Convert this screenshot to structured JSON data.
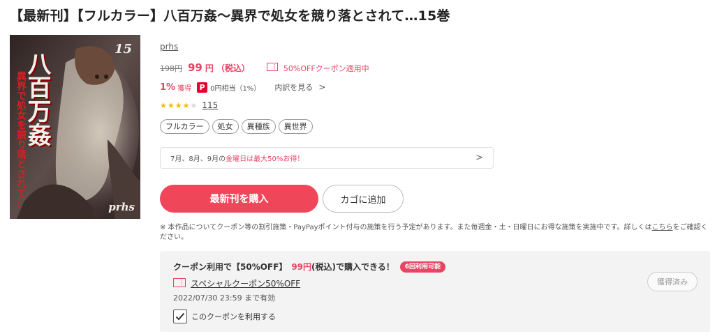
{
  "product": {
    "title": "【最新刊】【フルカラー】八百万姦〜異界で処女を競り落とされて…15巻",
    "author": "prhs",
    "cover": {
      "volume_number": "15",
      "series_title_art": "八百万姦",
      "subtitle_art": "異界で処女を競り落とされて…",
      "publisher_art": "prhs",
      "colors": {
        "bg_dark": "#3a2a2a",
        "bg_mid": "#6b5a57",
        "title_red": "#c81e1e",
        "title_white": "#f2efe9"
      }
    }
  },
  "pricing": {
    "original_price": "198円",
    "price_value": "99",
    "price_unit": "円",
    "tax_label": "（税込）",
    "coupon_applied": "50%OFFクーポン適用中"
  },
  "points": {
    "percent": "1%",
    "earn_label": "獲得",
    "paypay_badge": "P",
    "paypay_text": "0円相当（1%）",
    "breakdown_label": "内訳を見る",
    "breakdown_icon": "chevron-right-icon"
  },
  "rating": {
    "stars": 3.5,
    "count": "115"
  },
  "tags": [
    "フルカラー",
    "処女",
    "異種族",
    "異世界"
  ],
  "campaign": {
    "text_pre": "7月、8月、9月の",
    "text_hl": "金曜日は最大50%お得！",
    "arrow_icon": "chevron-right-icon"
  },
  "actions": {
    "buy_label": "最新刊を購入",
    "cart_label": "カゴに追加"
  },
  "notice": {
    "text": "※ 本作品についてクーポン等の割引施策・PayPayポイント付与の施策を行う予定があります。また毎週金・土・日曜日にお得な施策を実施中です。詳しくは",
    "link": "こちら",
    "text_after": "をご確認ください。"
  },
  "coupon": {
    "headline_pre": "クーポン利用で【50%OFF】",
    "headline_price": "99円",
    "headline_post": "(税込)で購入できる！",
    "uses_badge": "6回利用可能",
    "name": "スペシャルクーポン50%OFF",
    "expiry": "2022/07/30 23:59 まで有効",
    "checkbox_label": "このクーポンを利用する",
    "checked": true,
    "acquired_label": "獲得済み"
  },
  "colors": {
    "accent": "#e84564",
    "buy_button": "#f0465a",
    "star": "#f5b800"
  }
}
